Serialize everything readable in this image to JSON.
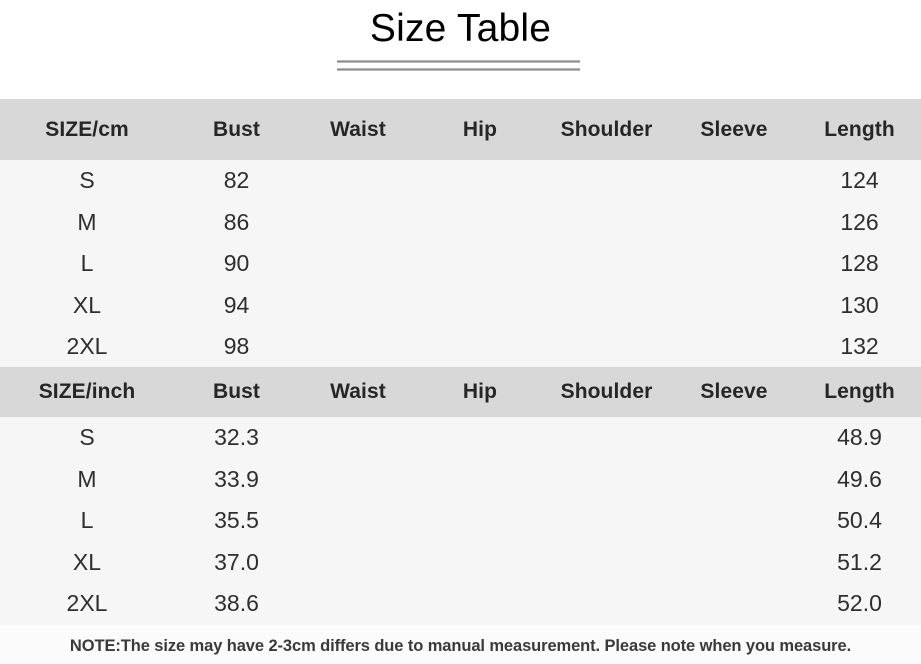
{
  "title": "Size Table",
  "colors": {
    "header_band": "#d8d8d8",
    "row_band": "#f6f6f6",
    "rule": "#8a8a8a",
    "text_dark": "#262626",
    "note_text": "#3a3a3a"
  },
  "columns": [
    "SIZE/cm",
    "Bust",
    "Waist",
    "Hip",
    "Shoulder",
    "Sleeve",
    "Length"
  ],
  "cm_section": {
    "headers": [
      "SIZE/cm",
      "Bust",
      "Waist",
      "Hip",
      "Shoulder",
      "Sleeve",
      "Length"
    ],
    "rows": [
      {
        "size": "S",
        "bust": "82",
        "waist": "",
        "hip": "",
        "shoulder": "",
        "sleeve": "",
        "length": "124"
      },
      {
        "size": "M",
        "bust": "86",
        "waist": "",
        "hip": "",
        "shoulder": "",
        "sleeve": "",
        "length": "126"
      },
      {
        "size": "L",
        "bust": "90",
        "waist": "",
        "hip": "",
        "shoulder": "",
        "sleeve": "",
        "length": "128"
      },
      {
        "size": "XL",
        "bust": "94",
        "waist": "",
        "hip": "",
        "shoulder": "",
        "sleeve": "",
        "length": "130"
      },
      {
        "size": "2XL",
        "bust": "98",
        "waist": "",
        "hip": "",
        "shoulder": "",
        "sleeve": "",
        "length": "132"
      }
    ]
  },
  "inch_section": {
    "headers": [
      "SIZE/inch",
      "Bust",
      "Waist",
      "Hip",
      "Shoulder",
      "Sleeve",
      "Length"
    ],
    "rows": [
      {
        "size": "S",
        "bust": "32.3",
        "waist": "",
        "hip": "",
        "shoulder": "",
        "sleeve": "",
        "length": "48.9"
      },
      {
        "size": "M",
        "bust": "33.9",
        "waist": "",
        "hip": "",
        "shoulder": "",
        "sleeve": "",
        "length": "49.6"
      },
      {
        "size": "L",
        "bust": "35.5",
        "waist": "",
        "hip": "",
        "shoulder": "",
        "sleeve": "",
        "length": "50.4"
      },
      {
        "size": "XL",
        "bust": "37.0",
        "waist": "",
        "hip": "",
        "shoulder": "",
        "sleeve": "",
        "length": "51.2"
      },
      {
        "size": "2XL",
        "bust": "38.6",
        "waist": "",
        "hip": "",
        "shoulder": "",
        "sleeve": "",
        "length": "52.0"
      }
    ]
  },
  "note": "NOTE:The size may have 2-3cm differs due to manual measurement. Please note when you measure."
}
